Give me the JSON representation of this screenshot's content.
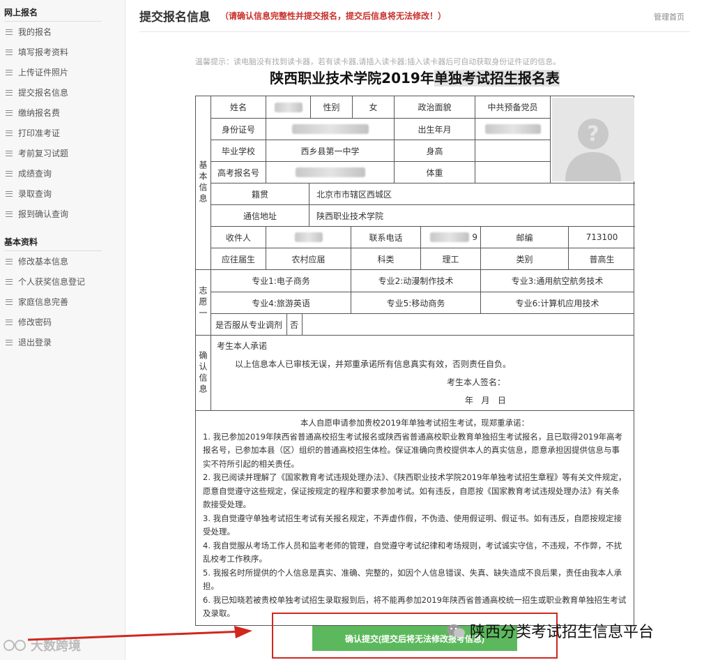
{
  "sidebar": {
    "section1": "网上报名",
    "items1": [
      "我的报名",
      "填写报考资料",
      "上传证件照片",
      "提交报名信息",
      "缴纳报名费",
      "打印准考证",
      "考前复习试题",
      "成绩查询",
      "录取查询",
      "报到确认查询"
    ],
    "section2": "基本资料",
    "items2": [
      "修改基本信息",
      "个人获奖信息登记",
      "家庭信息完善",
      "修改密码",
      "退出登录"
    ],
    "watermark": "大数跨境"
  },
  "header": {
    "title": "提交报名信息",
    "warning": "（请确认信息完整性并提交报名，提交后信息将无法修改！）",
    "home_link": "管理首页"
  },
  "tip": "温馨提示：读电脑没有找到读卡器，若有读卡器,请插入读卡器;插入读卡器后可自动获取身份证件证的信息。",
  "form_title_a": "陕西职业技术学院2019年",
  "form_title_b": "单独考试招生报名表",
  "sections": {
    "basic": "基本信息",
    "wish": "志愿一",
    "confirm": "确认信息"
  },
  "basic": {
    "name_label": "姓名",
    "gender_label": "性别",
    "gender": "女",
    "politics_label": "政治面貌",
    "politics": "中共预备党员",
    "id_label": "身份证号",
    "birth_label": "出生年月",
    "school_label": "毕业学校",
    "school": "西乡县第一中学",
    "height_label": "身高",
    "exam_no_label": "高考报名号",
    "weight_label": "体重",
    "native_label": "籍贯",
    "native": "北京市市辖区西城区",
    "address_label": "通信地址",
    "address": "陕西职业技术学院",
    "receiver_label": "收件人",
    "phone_label": "联系电话",
    "phone_tail": "9",
    "postcode_label": "邮编",
    "postcode": "713100",
    "grad_label": "应往届生",
    "hukou": "农村应届",
    "subject_label": "科类",
    "subject": "理工",
    "category_label": "类别",
    "category": "普高生"
  },
  "wishes": [
    "专业1:电子商务",
    "专业2:动漫制作技术",
    "专业3:通用航空航务技术",
    "专业4:旅游英语",
    "专业5:移动商务",
    "专业6:计算机应用技术"
  ],
  "adjust_label": "是否服从专业调剂",
  "adjust_value": "否",
  "confirm": {
    "title": "考生本人承诺",
    "text": "以上信息本人已审核无误，并郑重承诺所有信息真实有效，否则责任自负。",
    "sign": "考生本人签名：",
    "date": "年   月   日"
  },
  "pledge": {
    "head": "本人自愿申请参加贵校2019年单独考试招生考试，现郑重承诺：",
    "items": [
      "1. 我已参加2019年陕西省普通高校招生考试报名或陕西省普通高校职业教育单独招生考试报名，且已取得2019年高考报名号，已参加本县（区）组织的普通高校招生体检。保证准确向贵校提供本人的真实信息，愿意承担因提供信息与事实不符所引起的相关责任。",
      "2. 我已阅读并理解了《国家教育考试违规处理办法》、《陕西职业技术学院2019年单独考试招生章程》等有关文件规定，愿意自觉遵守这些规定，保证按规定的程序和要求参加考试。如有违反，自愿按《国家教育考试违规处理办法》有关条款接受处理。",
      "3. 我自觉遵守单独考试招生考试有关报名规定，不弄虚作假，不伪造、使用假证明、假证书。如有违反，自愿按规定接受处理。",
      "4. 我自觉服从考场工作人员和监考老师的管理，自觉遵守考试纪律和考场规则，考试诚实守信，不违规，不作弊，不扰乱校考工作秩序。",
      "5. 我报名时所提供的个人信息是真实、准确、完整的，如因个人信息错误、失真、缺失造成不良后果，责任由我本人承担。",
      "6. 我已知晓若被贵校单独考试招生录取报到后，将不能再参加2019年陕西省普通高校统一招生或职业教育单独招生考试及录取。"
    ]
  },
  "submit": {
    "label": "确认提交(提交后将无法修改报考信息)"
  },
  "watermark_right": "陕西分类考试招生信息平台",
  "colors": {
    "warning": "#c9302c",
    "submit": "#5cb85c",
    "frame": "#d0271f"
  }
}
